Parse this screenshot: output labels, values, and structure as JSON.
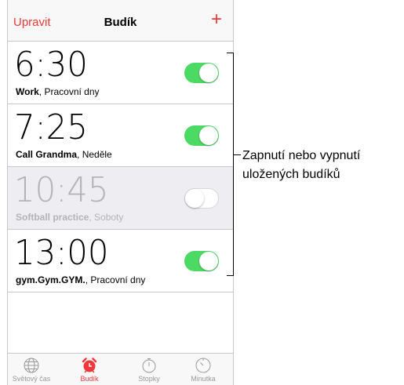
{
  "nav": {
    "edit_label": "Upravit",
    "title": "Budík",
    "add_label": "+"
  },
  "alarms": [
    {
      "time": "6:30",
      "label": "Work",
      "sub": ", Pracovní dny",
      "enabled": true
    },
    {
      "time": "7:25",
      "label": "Call Grandma",
      "sub": ", Neděle",
      "enabled": true
    },
    {
      "time": "10:45",
      "label": "Softball practice",
      "sub": ", Soboty",
      "enabled": false
    },
    {
      "time": "13:00",
      "label": "gym.Gym.GYM.",
      "sub": ", Pracovní dny",
      "enabled": true
    }
  ],
  "tabs": [
    {
      "label": "Světový čas",
      "icon": "globe-icon",
      "active": false
    },
    {
      "label": "Budík",
      "icon": "alarm-clock-icon",
      "active": true
    },
    {
      "label": "Stopky",
      "icon": "stopwatch-icon",
      "active": false
    },
    {
      "label": "Minutka",
      "icon": "timer-icon",
      "active": false
    }
  ],
  "callout": {
    "line1": "Zapnutí nebo vypnutí",
    "line2": "uložených budíků"
  },
  "colors": {
    "accent": "#f0383a",
    "toggle_on": "#4cd964",
    "disabled_row": "#ededf2"
  }
}
